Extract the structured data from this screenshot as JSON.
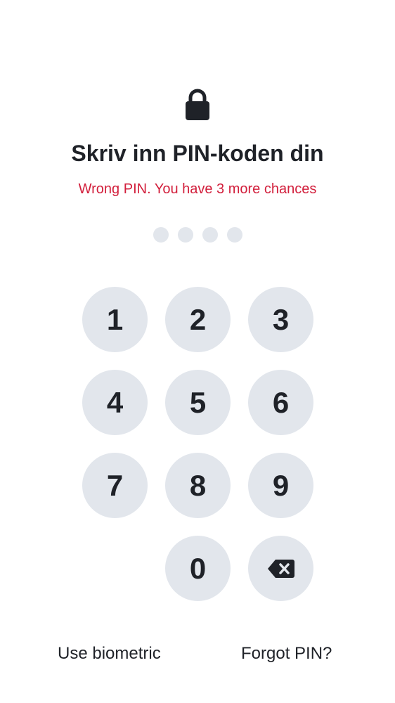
{
  "lock": {
    "icon": "lock-icon"
  },
  "title": "Skriv inn PIN-koden din",
  "error": "Wrong PIN. You have 3 more chances",
  "pin": {
    "length": 4,
    "filled": 0
  },
  "keypad": {
    "keys": [
      "1",
      "2",
      "3",
      "4",
      "5",
      "6",
      "7",
      "8",
      "9",
      "0"
    ],
    "delete_icon": "backspace-icon"
  },
  "footer": {
    "biometric_label": "Use biometric",
    "forgot_label": "Forgot PIN?"
  },
  "colors": {
    "error": "#d21f3c",
    "key_background": "#e2e6ec",
    "text": "#1f2228"
  }
}
